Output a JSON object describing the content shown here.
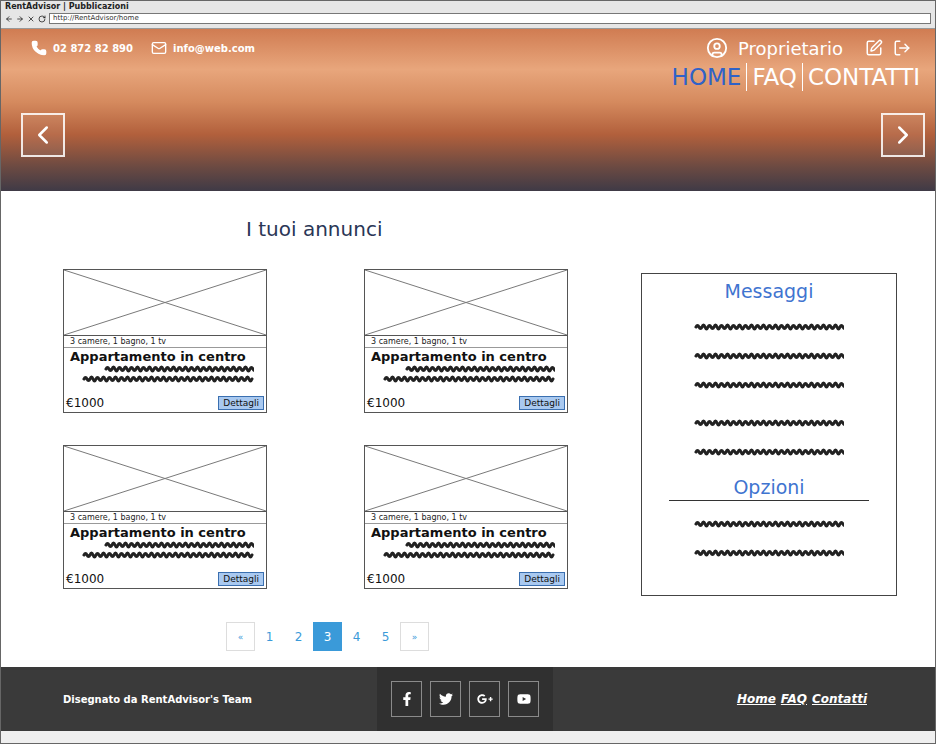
{
  "window": {
    "title": "RentAdvisor | Pubblicazioni",
    "url": "http://RentAdvisor/home"
  },
  "header": {
    "phone": "02 872 82 890",
    "email": "info@web.com",
    "user": "Proprietario",
    "nav": [
      {
        "label": "HOME",
        "selected": true
      },
      {
        "label": "FAQ",
        "selected": false
      },
      {
        "label": "CONTATTI",
        "selected": false
      }
    ]
  },
  "main": {
    "title": "I tuoi annunci"
  },
  "listings": [
    {
      "features": "3 camere, 1 bagno, 1 tv",
      "title": "Appartamento in centro",
      "price": "€1000",
      "button": "Dettagli"
    },
    {
      "features": "3 camere, 1 bagno, 1 tv",
      "title": "Appartamento in centro",
      "price": "€1000",
      "button": "Dettagli"
    },
    {
      "features": "3 camere, 1 bagno, 1 tv",
      "title": "Appartamento in centro",
      "price": "€1000",
      "button": "Dettagli"
    },
    {
      "features": "3 camere, 1 bagno, 1 tv",
      "title": "Appartamento in centro",
      "price": "€1000",
      "button": "Dettagli"
    }
  ],
  "sidebar": {
    "sections": [
      {
        "title": "Messaggi"
      },
      {
        "title": "Opzioni"
      }
    ]
  },
  "pagination": [
    {
      "label": "«",
      "selected": false
    },
    {
      "label": "1",
      "selected": false
    },
    {
      "label": "2",
      "selected": false
    },
    {
      "label": "3",
      "selected": true
    },
    {
      "label": "4",
      "selected": false
    },
    {
      "label": "5",
      "selected": false
    },
    {
      "label": "»",
      "selected": false
    }
  ],
  "footer": {
    "credit": "Disegnato da RentAdvisor's Team",
    "links": [
      "Home",
      "FAQ",
      "Contatti"
    ]
  }
}
